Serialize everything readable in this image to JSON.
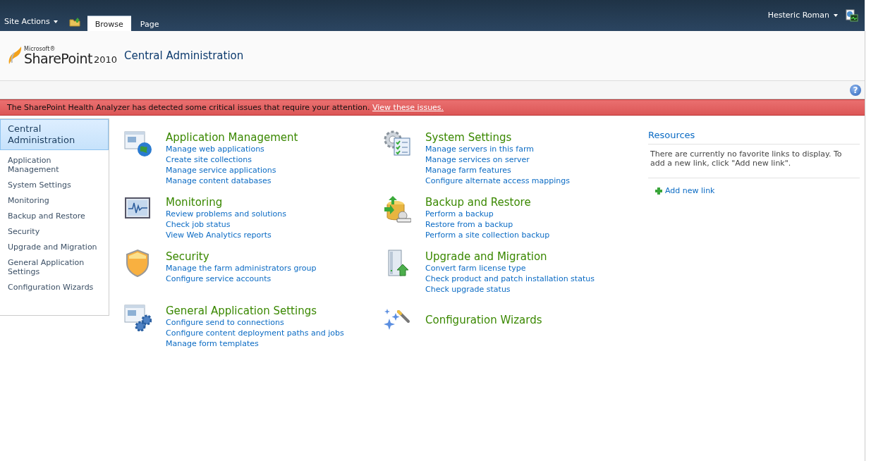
{
  "top_bar": {
    "site_actions": "Site Actions",
    "tabs": [
      {
        "label": "Browse",
        "selected": true
      },
      {
        "label": "Page",
        "selected": false
      }
    ],
    "user": "Hesteric Roman"
  },
  "header": {
    "logo": {
      "maker": "Microsoft®",
      "product": "SharePoint",
      "version": "2010"
    },
    "title": "Central Administration"
  },
  "help": "?",
  "alert": {
    "message": "The SharePoint Health Analyzer has detected some critical issues that require your attention.",
    "link": "View these issues."
  },
  "sidebar": {
    "items": [
      {
        "label": "Central Administration",
        "selected": true
      },
      {
        "label": "Application Management",
        "selected": false
      },
      {
        "label": "System Settings",
        "selected": false
      },
      {
        "label": "Monitoring",
        "selected": false
      },
      {
        "label": "Backup and Restore",
        "selected": false
      },
      {
        "label": "Security",
        "selected": false
      },
      {
        "label": "Upgrade and Migration",
        "selected": false
      },
      {
        "label": "General Application Settings",
        "selected": false
      },
      {
        "label": "Configuration Wizards",
        "selected": false
      }
    ]
  },
  "sections": [
    {
      "title": "Application Management",
      "links": [
        "Manage web applications",
        "Create site collections",
        "Manage service applications",
        "Manage content databases"
      ]
    },
    {
      "title": "System Settings",
      "links": [
        "Manage servers in this farm",
        "Manage services on server",
        "Manage farm features",
        "Configure alternate access mappings"
      ]
    },
    {
      "title": "Monitoring",
      "links": [
        "Review problems and solutions",
        "Check job status",
        "View Web Analytics reports"
      ]
    },
    {
      "title": "Backup and Restore",
      "links": [
        "Perform a backup",
        "Restore from a backup",
        "Perform a site collection backup"
      ]
    },
    {
      "title": "Security",
      "links": [
        "Manage the farm administrators group",
        "Configure service accounts"
      ]
    },
    {
      "title": "Upgrade and Migration",
      "links": [
        "Convert farm license type",
        "Check product and patch installation status",
        "Check upgrade status"
      ]
    },
    {
      "title": "General Application Settings",
      "links": [
        "Configure send to connections",
        "Configure content deployment paths and jobs",
        "Manage form templates"
      ]
    },
    {
      "title": "Configuration Wizards"
    }
  ],
  "resources": {
    "title": "Resources",
    "message": "There are currently no favorite links to display. To add a new link, click \"Add new link\".",
    "add_link": "Add new link"
  }
}
